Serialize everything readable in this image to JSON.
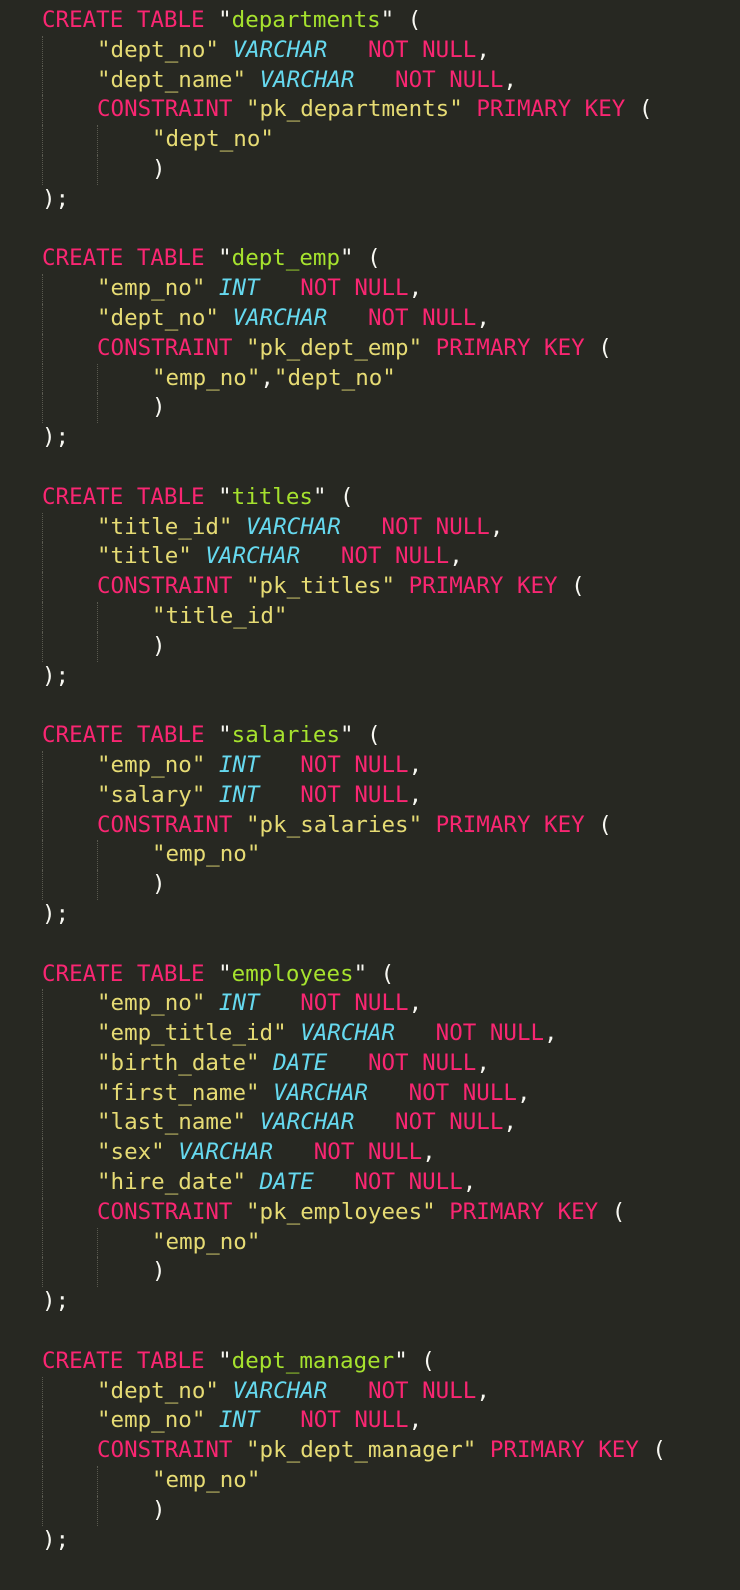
{
  "editor": {
    "colors": {
      "background": "#272822",
      "keyword": "#f92672",
      "string": "#e6db74",
      "table_name": "#a6e22e",
      "type": "#66d9ef",
      "punctuation": "#f8f8f2"
    },
    "lines": [
      {
        "indent": 0,
        "tokens": [
          [
            "kw",
            "CREATE TABLE"
          ],
          [
            "pun",
            " \""
          ],
          [
            "tbl",
            "departments"
          ],
          [
            "pun",
            "\" ("
          ]
        ]
      },
      {
        "indent": 1,
        "tokens": [
          [
            "str",
            "\"dept_no\""
          ],
          [
            "pun",
            " "
          ],
          [
            "type",
            "VARCHAR"
          ],
          [
            "pun",
            "   "
          ],
          [
            "kw",
            "NOT NULL"
          ],
          [
            "pun",
            ","
          ]
        ]
      },
      {
        "indent": 1,
        "tokens": [
          [
            "str",
            "\"dept_name\""
          ],
          [
            "pun",
            " "
          ],
          [
            "type",
            "VARCHAR"
          ],
          [
            "pun",
            "   "
          ],
          [
            "kw",
            "NOT NULL"
          ],
          [
            "pun",
            ","
          ]
        ]
      },
      {
        "indent": 1,
        "tokens": [
          [
            "kw",
            "CONSTRAINT"
          ],
          [
            "pun",
            " "
          ],
          [
            "str",
            "\"pk_departments\""
          ],
          [
            "pun",
            " "
          ],
          [
            "kw",
            "PRIMARY KEY"
          ],
          [
            "pun",
            " ("
          ]
        ]
      },
      {
        "indent": 2,
        "tokens": [
          [
            "str",
            "\"dept_no\""
          ]
        ]
      },
      {
        "indent": 2,
        "tokens": [
          [
            "pun",
            ")"
          ]
        ]
      },
      {
        "indent": 0,
        "tokens": [
          [
            "pun",
            ");"
          ]
        ]
      },
      {
        "indent": 0,
        "tokens": []
      },
      {
        "indent": 0,
        "tokens": [
          [
            "kw",
            "CREATE TABLE"
          ],
          [
            "pun",
            " \""
          ],
          [
            "tbl",
            "dept_emp"
          ],
          [
            "pun",
            "\" ("
          ]
        ]
      },
      {
        "indent": 1,
        "tokens": [
          [
            "str",
            "\"emp_no\""
          ],
          [
            "pun",
            " "
          ],
          [
            "type",
            "INT"
          ],
          [
            "pun",
            "   "
          ],
          [
            "kw",
            "NOT NULL"
          ],
          [
            "pun",
            ","
          ]
        ]
      },
      {
        "indent": 1,
        "tokens": [
          [
            "str",
            "\"dept_no\""
          ],
          [
            "pun",
            " "
          ],
          [
            "type",
            "VARCHAR"
          ],
          [
            "pun",
            "   "
          ],
          [
            "kw",
            "NOT NULL"
          ],
          [
            "pun",
            ","
          ]
        ]
      },
      {
        "indent": 1,
        "tokens": [
          [
            "kw",
            "CONSTRAINT"
          ],
          [
            "pun",
            " "
          ],
          [
            "str",
            "\"pk_dept_emp\""
          ],
          [
            "pun",
            " "
          ],
          [
            "kw",
            "PRIMARY KEY"
          ],
          [
            "pun",
            " ("
          ]
        ]
      },
      {
        "indent": 2,
        "tokens": [
          [
            "str",
            "\"emp_no\""
          ],
          [
            "pun",
            ","
          ],
          [
            "str",
            "\"dept_no\""
          ]
        ]
      },
      {
        "indent": 2,
        "tokens": [
          [
            "pun",
            ")"
          ]
        ]
      },
      {
        "indent": 0,
        "tokens": [
          [
            "pun",
            ");"
          ]
        ]
      },
      {
        "indent": 0,
        "tokens": []
      },
      {
        "indent": 0,
        "tokens": [
          [
            "kw",
            "CREATE TABLE"
          ],
          [
            "pun",
            " \""
          ],
          [
            "tbl",
            "titles"
          ],
          [
            "pun",
            "\" ("
          ]
        ]
      },
      {
        "indent": 1,
        "tokens": [
          [
            "str",
            "\"title_id\""
          ],
          [
            "pun",
            " "
          ],
          [
            "type",
            "VARCHAR"
          ],
          [
            "pun",
            "   "
          ],
          [
            "kw",
            "NOT NULL"
          ],
          [
            "pun",
            ","
          ]
        ]
      },
      {
        "indent": 1,
        "tokens": [
          [
            "str",
            "\"title\""
          ],
          [
            "pun",
            " "
          ],
          [
            "type",
            "VARCHAR"
          ],
          [
            "pun",
            "   "
          ],
          [
            "kw",
            "NOT NULL"
          ],
          [
            "pun",
            ","
          ]
        ]
      },
      {
        "indent": 1,
        "tokens": [
          [
            "kw",
            "CONSTRAINT"
          ],
          [
            "pun",
            " "
          ],
          [
            "str",
            "\"pk_titles\""
          ],
          [
            "pun",
            " "
          ],
          [
            "kw",
            "PRIMARY KEY"
          ],
          [
            "pun",
            " ("
          ]
        ]
      },
      {
        "indent": 2,
        "tokens": [
          [
            "str",
            "\"title_id\""
          ]
        ]
      },
      {
        "indent": 2,
        "tokens": [
          [
            "pun",
            ")"
          ]
        ]
      },
      {
        "indent": 0,
        "tokens": [
          [
            "pun",
            ");"
          ]
        ]
      },
      {
        "indent": 0,
        "tokens": []
      },
      {
        "indent": 0,
        "tokens": [
          [
            "kw",
            "CREATE TABLE"
          ],
          [
            "pun",
            " \""
          ],
          [
            "tbl",
            "salaries"
          ],
          [
            "pun",
            "\" ("
          ]
        ]
      },
      {
        "indent": 1,
        "tokens": [
          [
            "str",
            "\"emp_no\""
          ],
          [
            "pun",
            " "
          ],
          [
            "type",
            "INT"
          ],
          [
            "pun",
            "   "
          ],
          [
            "kw",
            "NOT NULL"
          ],
          [
            "pun",
            ","
          ]
        ]
      },
      {
        "indent": 1,
        "tokens": [
          [
            "str",
            "\"salary\""
          ],
          [
            "pun",
            " "
          ],
          [
            "type",
            "INT"
          ],
          [
            "pun",
            "   "
          ],
          [
            "kw",
            "NOT NULL"
          ],
          [
            "pun",
            ","
          ]
        ]
      },
      {
        "indent": 1,
        "tokens": [
          [
            "kw",
            "CONSTRAINT"
          ],
          [
            "pun",
            " "
          ],
          [
            "str",
            "\"pk_salaries\""
          ],
          [
            "pun",
            " "
          ],
          [
            "kw",
            "PRIMARY KEY"
          ],
          [
            "pun",
            " ("
          ]
        ]
      },
      {
        "indent": 2,
        "tokens": [
          [
            "str",
            "\"emp_no\""
          ]
        ]
      },
      {
        "indent": 2,
        "tokens": [
          [
            "pun",
            ")"
          ]
        ]
      },
      {
        "indent": 0,
        "tokens": [
          [
            "pun",
            ");"
          ]
        ]
      },
      {
        "indent": 0,
        "tokens": []
      },
      {
        "indent": 0,
        "tokens": [
          [
            "kw",
            "CREATE TABLE"
          ],
          [
            "pun",
            " \""
          ],
          [
            "tbl",
            "employees"
          ],
          [
            "pun",
            "\" ("
          ]
        ]
      },
      {
        "indent": 1,
        "tokens": [
          [
            "str",
            "\"emp_no\""
          ],
          [
            "pun",
            " "
          ],
          [
            "type",
            "INT"
          ],
          [
            "pun",
            "   "
          ],
          [
            "kw",
            "NOT NULL"
          ],
          [
            "pun",
            ","
          ]
        ]
      },
      {
        "indent": 1,
        "tokens": [
          [
            "str",
            "\"emp_title_id\""
          ],
          [
            "pun",
            " "
          ],
          [
            "type",
            "VARCHAR"
          ],
          [
            "pun",
            "   "
          ],
          [
            "kw",
            "NOT NULL"
          ],
          [
            "pun",
            ","
          ]
        ]
      },
      {
        "indent": 1,
        "tokens": [
          [
            "str",
            "\"birth_date\""
          ],
          [
            "pun",
            " "
          ],
          [
            "type",
            "DATE"
          ],
          [
            "pun",
            "   "
          ],
          [
            "kw",
            "NOT NULL"
          ],
          [
            "pun",
            ","
          ]
        ]
      },
      {
        "indent": 1,
        "tokens": [
          [
            "str",
            "\"first_name\""
          ],
          [
            "pun",
            " "
          ],
          [
            "type",
            "VARCHAR"
          ],
          [
            "pun",
            "   "
          ],
          [
            "kw",
            "NOT NULL"
          ],
          [
            "pun",
            ","
          ]
        ]
      },
      {
        "indent": 1,
        "tokens": [
          [
            "str",
            "\"last_name\""
          ],
          [
            "pun",
            " "
          ],
          [
            "type",
            "VARCHAR"
          ],
          [
            "pun",
            "   "
          ],
          [
            "kw",
            "NOT NULL"
          ],
          [
            "pun",
            ","
          ]
        ]
      },
      {
        "indent": 1,
        "tokens": [
          [
            "str",
            "\"sex\""
          ],
          [
            "pun",
            " "
          ],
          [
            "type",
            "VARCHAR"
          ],
          [
            "pun",
            "   "
          ],
          [
            "kw",
            "NOT NULL"
          ],
          [
            "pun",
            ","
          ]
        ]
      },
      {
        "indent": 1,
        "tokens": [
          [
            "str",
            "\"hire_date\""
          ],
          [
            "pun",
            " "
          ],
          [
            "type",
            "DATE"
          ],
          [
            "pun",
            "   "
          ],
          [
            "kw",
            "NOT NULL"
          ],
          [
            "pun",
            ","
          ]
        ]
      },
      {
        "indent": 1,
        "tokens": [
          [
            "kw",
            "CONSTRAINT"
          ],
          [
            "pun",
            " "
          ],
          [
            "str",
            "\"pk_employees\""
          ],
          [
            "pun",
            " "
          ],
          [
            "kw",
            "PRIMARY KEY"
          ],
          [
            "pun",
            " ("
          ]
        ]
      },
      {
        "indent": 2,
        "tokens": [
          [
            "str",
            "\"emp_no\""
          ]
        ]
      },
      {
        "indent": 2,
        "tokens": [
          [
            "pun",
            ")"
          ]
        ]
      },
      {
        "indent": 0,
        "tokens": [
          [
            "pun",
            ");"
          ]
        ]
      },
      {
        "indent": 0,
        "tokens": []
      },
      {
        "indent": 0,
        "tokens": [
          [
            "kw",
            "CREATE TABLE"
          ],
          [
            "pun",
            " \""
          ],
          [
            "tbl",
            "dept_manager"
          ],
          [
            "pun",
            "\" ("
          ]
        ]
      },
      {
        "indent": 1,
        "tokens": [
          [
            "str",
            "\"dept_no\""
          ],
          [
            "pun",
            " "
          ],
          [
            "type",
            "VARCHAR"
          ],
          [
            "pun",
            "   "
          ],
          [
            "kw",
            "NOT NULL"
          ],
          [
            "pun",
            ","
          ]
        ]
      },
      {
        "indent": 1,
        "tokens": [
          [
            "str",
            "\"emp_no\""
          ],
          [
            "pun",
            " "
          ],
          [
            "type",
            "INT"
          ],
          [
            "pun",
            "   "
          ],
          [
            "kw",
            "NOT NULL"
          ],
          [
            "pun",
            ","
          ]
        ]
      },
      {
        "indent": 1,
        "tokens": [
          [
            "kw",
            "CONSTRAINT"
          ],
          [
            "pun",
            " "
          ],
          [
            "str",
            "\"pk_dept_manager\""
          ],
          [
            "pun",
            " "
          ],
          [
            "kw",
            "PRIMARY KEY"
          ],
          [
            "pun",
            " ("
          ]
        ]
      },
      {
        "indent": 2,
        "tokens": [
          [
            "str",
            "\"emp_no\""
          ]
        ]
      },
      {
        "indent": 2,
        "tokens": [
          [
            "pun",
            ")"
          ]
        ]
      },
      {
        "indent": 0,
        "tokens": [
          [
            "pun",
            ");"
          ]
        ]
      }
    ]
  }
}
